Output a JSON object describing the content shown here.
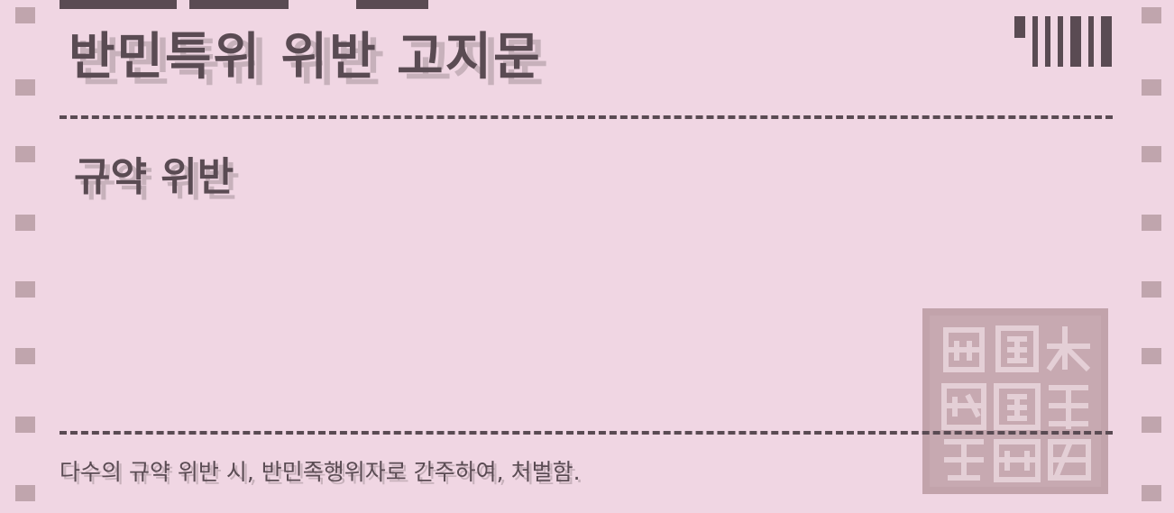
{
  "notice": {
    "title": "반민특위 위반 고지문",
    "subtitle": "규약 위반",
    "footer": "다수의 규약 위반 시, 반민족행위자로 간주하여, 처벌함."
  },
  "seal": {
    "icon": "square-seal-stamp-icon"
  },
  "barcode": {
    "icon": "barcode-icon"
  },
  "colors": {
    "background": "#f0d6e3",
    "ink": "#5a4b53",
    "shadow": "#c7b1bb",
    "perforation": "#c0a5ad",
    "seal": "#c7a9b1"
  }
}
